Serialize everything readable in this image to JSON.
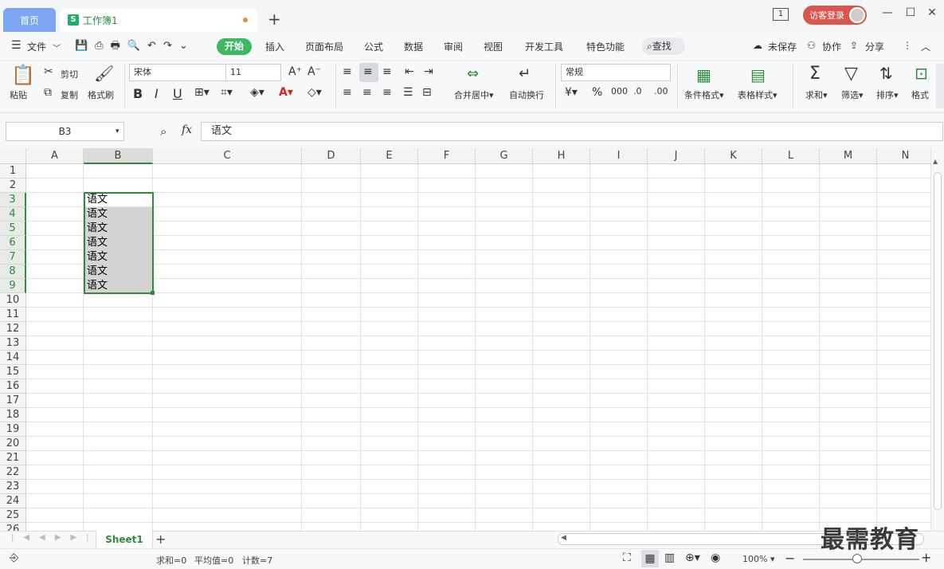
{
  "tabs": {
    "home": "首页",
    "workbook": "工作簿1",
    "workbook_icon": "S"
  },
  "titlebar": {
    "window_count": "1",
    "login": "访客登录"
  },
  "menu": {
    "file": "文件",
    "items": [
      "开始",
      "插入",
      "页面布局",
      "公式",
      "数据",
      "审阅",
      "视图",
      "开发工具",
      "特色功能"
    ],
    "search": "查找",
    "unsaved": "未保存",
    "collab": "协作",
    "share": "分享"
  },
  "ribbon": {
    "paste": "粘贴",
    "cut": "剪切",
    "copy": "复制",
    "format_painter": "格式刷",
    "font_name": "宋体",
    "font_size": "11",
    "merge_center": "合并居中",
    "wrap_text": "自动换行",
    "number_format": "常规",
    "cond_format": "条件格式",
    "table_style": "表格样式",
    "sum": "求和",
    "filter": "筛选",
    "sort": "排序",
    "format": "格式"
  },
  "formula_bar": {
    "name_box": "B3",
    "fx": "fx",
    "value": "语文"
  },
  "grid": {
    "columns": [
      "A",
      "B",
      "C",
      "D",
      "E",
      "F",
      "G",
      "H",
      "I",
      "J",
      "K",
      "L",
      "M",
      "N"
    ],
    "rows": [
      "1",
      "2",
      "3",
      "4",
      "5",
      "6",
      "7",
      "8",
      "9",
      "10",
      "11",
      "12",
      "13",
      "14",
      "15",
      "16",
      "17",
      "18",
      "19",
      "20",
      "21",
      "22",
      "23",
      "24",
      "25",
      "26"
    ],
    "b_cells": [
      "语文",
      "语文",
      "语文",
      "语文",
      "语文",
      "语文",
      "语文"
    ],
    "selected_color": "#2e8b3c"
  },
  "sheets": {
    "active": "Sheet1"
  },
  "status": {
    "sum": "求和=0",
    "avg": "平均值=0",
    "count": "计数=7",
    "zoom": "100%"
  },
  "watermark": "最需教育"
}
